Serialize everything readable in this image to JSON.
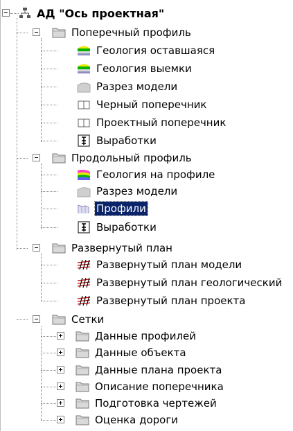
{
  "tree": {
    "root": {
      "label": "АД \"Ось проектная\"",
      "icon": "network-icon"
    },
    "sections": [
      {
        "label": "Поперечный профиль",
        "icon": "folder-icon",
        "expanded": true,
        "children": [
          {
            "label": "Геология оставшаяся",
            "icon": "geology-layers-icon"
          },
          {
            "label": "Геология выемки",
            "icon": "geology-layers-icon"
          },
          {
            "label": "Разрез модели",
            "icon": "model-section-icon"
          },
          {
            "label": "Черный поперечник",
            "icon": "cross-section-icon"
          },
          {
            "label": "Проектный поперечник",
            "icon": "cross-section-icon"
          },
          {
            "label": "Выработки",
            "icon": "borehole-icon"
          }
        ]
      },
      {
        "label": "Продольный профиль",
        "icon": "folder-icon",
        "expanded": true,
        "children": [
          {
            "label": "Геология на профиле",
            "icon": "geology-profile-icon"
          },
          {
            "label": "Разрез модели",
            "icon": "model-section-icon"
          },
          {
            "label": "Профили",
            "icon": "profiles-icon",
            "selected": true
          },
          {
            "label": "Выработки",
            "icon": "borehole-icon"
          }
        ]
      },
      {
        "label": "Развернутый план",
        "icon": "folder-icon",
        "expanded": true,
        "children": [
          {
            "label": "Развернутый план модели",
            "icon": "plan-lines-icon"
          },
          {
            "label": "Развернутый план геологический",
            "icon": "plan-lines-icon"
          },
          {
            "label": "Развернутый план проекта",
            "icon": "plan-lines-icon"
          }
        ]
      },
      {
        "label": "Сетки",
        "icon": "folder-icon",
        "expanded": true,
        "children": [
          {
            "label": "Данные профилей",
            "icon": "folder-icon",
            "collapsed": true
          },
          {
            "label": "Данные объекта",
            "icon": "folder-icon",
            "collapsed": true
          },
          {
            "label": "Данные плана проекта",
            "icon": "folder-icon",
            "collapsed": true
          },
          {
            "label": "Описание поперечника",
            "icon": "folder-icon",
            "collapsed": true
          },
          {
            "label": "Подготовка чертежей",
            "icon": "folder-icon",
            "collapsed": true
          },
          {
            "label": "Оценка дороги",
            "icon": "folder-icon",
            "collapsed": true
          }
        ]
      }
    ]
  }
}
